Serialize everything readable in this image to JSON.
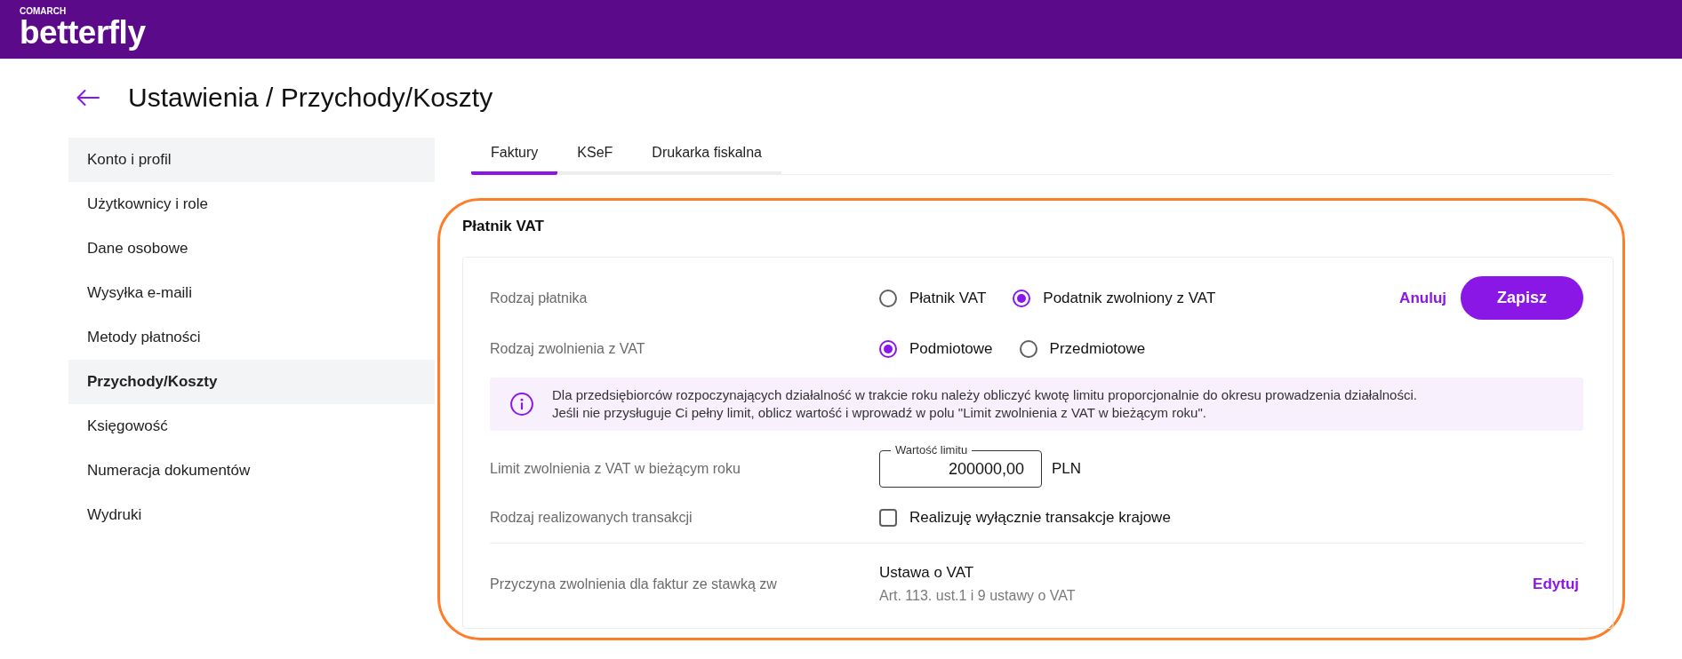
{
  "header": {
    "company": "COMARCH",
    "product": "betterfly"
  },
  "page": {
    "title": "Ustawienia / Przychody/Koszty"
  },
  "sidebar": {
    "items": [
      {
        "label": "Konto i profil",
        "selected": false,
        "highlighted": true
      },
      {
        "label": "Użytkownicy i role",
        "selected": false,
        "highlighted": false
      },
      {
        "label": "Dane osobowe",
        "selected": false,
        "highlighted": false
      },
      {
        "label": "Wysyłka e-maili",
        "selected": false,
        "highlighted": false
      },
      {
        "label": "Metody płatności",
        "selected": false,
        "highlighted": false
      },
      {
        "label": "Przychody/Koszty",
        "selected": true,
        "highlighted": true
      },
      {
        "label": "Księgowość",
        "selected": false,
        "highlighted": false
      },
      {
        "label": "Numeracja dokumentów",
        "selected": false,
        "highlighted": false
      },
      {
        "label": "Wydruki",
        "selected": false,
        "highlighted": false
      }
    ]
  },
  "tabs": [
    {
      "label": "Faktury",
      "selected": true
    },
    {
      "label": "KSeF",
      "selected": false
    },
    {
      "label": "Drukarka fiskalna",
      "selected": false
    }
  ],
  "section": {
    "title": "Płatnik VAT",
    "rows": [
      {
        "kind": "radio",
        "label": "Rodzaj płatnika",
        "options": [
          {
            "label": "Płatnik VAT",
            "selected": false
          },
          {
            "label": "Podatnik zwolniony z VAT",
            "selected": true
          }
        ],
        "actions": {
          "cancel": "Anuluj",
          "save": "Zapisz"
        }
      },
      {
        "kind": "radio",
        "label": "Rodzaj zwolnienia z VAT",
        "options": [
          {
            "label": "Podmiotowe",
            "selected": true
          },
          {
            "label": "Przedmiotowe",
            "selected": false
          }
        ]
      },
      {
        "kind": "info",
        "lines": [
          "Dla przedsiębiorców rozpoczynających działalność w trakcie roku należy obliczyć kwotę limitu proporcjonalnie do okresu prowadzenia działalności.",
          "Jeśli nie przysługuje Ci pełny limit, oblicz wartość i wprowadź w polu \"Limit zwolnienia z VAT w bieżącym roku\"."
        ]
      },
      {
        "kind": "amount",
        "label": "Limit zwolnienia z VAT w bieżącym roku",
        "field_label": "Wartość limitu",
        "value": "200000,00",
        "unit": "PLN"
      },
      {
        "kind": "checkbox",
        "label": "Rodzaj realizowanych transakcji",
        "option": {
          "label": "Realizuję wyłącznie transakcje krajowe",
          "checked": false
        }
      },
      {
        "kind": "detail",
        "label": "Przyczyna zwolnienia dla faktur ze stawką zw",
        "title": "Ustawa o VAT",
        "subtitle": "Art. 113. ust.1 i 9 ustawy o VAT",
        "action": "Edytuj"
      }
    ]
  }
}
